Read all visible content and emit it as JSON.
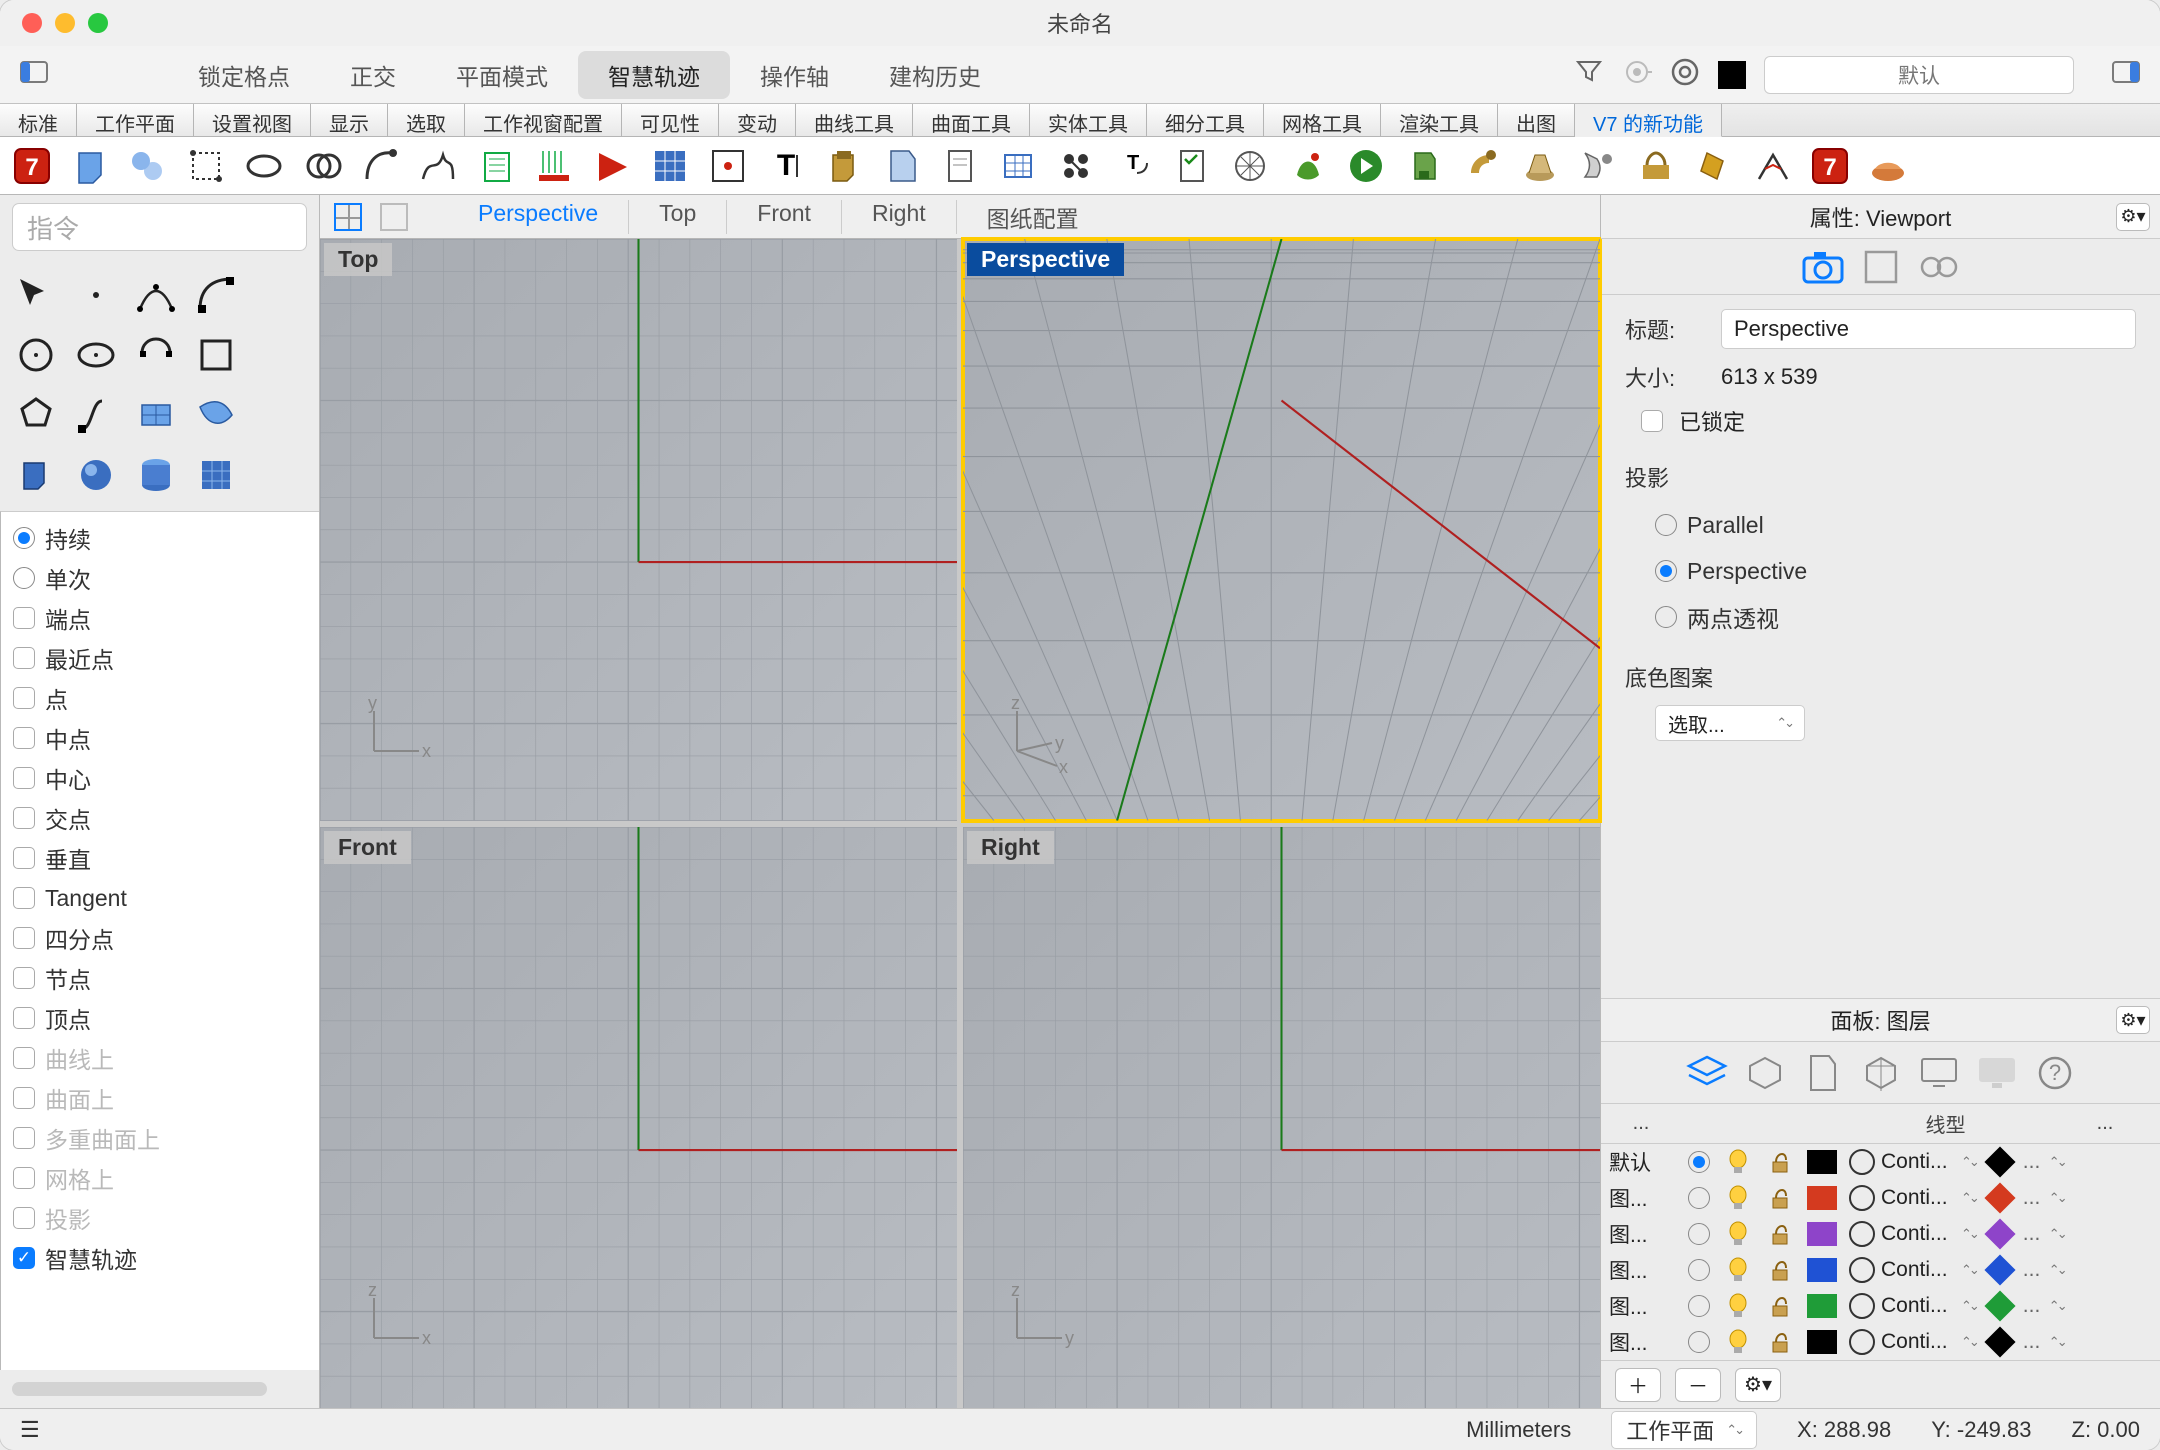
{
  "title": "未命名",
  "toolbar1": {
    "items": [
      "锁定格点",
      "正交",
      "平面模式",
      "智慧轨迹",
      "操作轴",
      "建构历史"
    ],
    "active": 3,
    "layer_selector": "默认"
  },
  "tabs": {
    "items": [
      "标准",
      "工作平面",
      "设置视图",
      "显示",
      "选取",
      "工作视窗配置",
      "可见性",
      "变动",
      "曲线工具",
      "曲面工具",
      "实体工具",
      "细分工具",
      "网格工具",
      "渲染工具",
      "出图",
      "V7 的新功能"
    ],
    "active": 15
  },
  "command_placeholder": "指令",
  "osnap": {
    "mode": [
      {
        "label": "持续",
        "on": true
      },
      {
        "label": "单次",
        "on": false
      }
    ],
    "checks": [
      {
        "label": "端点",
        "on": false,
        "disabled": false
      },
      {
        "label": "最近点",
        "on": false,
        "disabled": false
      },
      {
        "label": "点",
        "on": false,
        "disabled": false
      },
      {
        "label": "中点",
        "on": false,
        "disabled": false
      },
      {
        "label": "中心",
        "on": false,
        "disabled": false
      },
      {
        "label": "交点",
        "on": false,
        "disabled": false
      },
      {
        "label": "垂直",
        "on": false,
        "disabled": false
      },
      {
        "label": "Tangent",
        "on": false,
        "disabled": false
      },
      {
        "label": "四分点",
        "on": false,
        "disabled": false
      },
      {
        "label": "节点",
        "on": false,
        "disabled": false
      },
      {
        "label": "顶点",
        "on": false,
        "disabled": false
      },
      {
        "label": "曲线上",
        "on": false,
        "disabled": true
      },
      {
        "label": "曲面上",
        "on": false,
        "disabled": true
      },
      {
        "label": "多重曲面上",
        "on": false,
        "disabled": true
      },
      {
        "label": "网格上",
        "on": false,
        "disabled": true
      },
      {
        "label": "投影",
        "on": false,
        "disabled": true
      },
      {
        "label": "智慧轨迹",
        "on": true,
        "disabled": false
      }
    ]
  },
  "viewport_tabs": [
    "Perspective",
    "Top",
    "Front",
    "Right",
    "图纸配置"
  ],
  "viewport_active_tab": 0,
  "viewports": [
    {
      "name": "Top",
      "axes": [
        "x",
        "y"
      ],
      "active": false
    },
    {
      "name": "Perspective",
      "axes": [
        "x",
        "y",
        "z"
      ],
      "active": true
    },
    {
      "name": "Front",
      "axes": [
        "x",
        "z"
      ],
      "active": false
    },
    {
      "name": "Right",
      "axes": [
        "y",
        "z"
      ],
      "active": false
    }
  ],
  "properties": {
    "header": "属性: Viewport",
    "title_label": "标题:",
    "title_value": "Perspective",
    "size_label": "大小:",
    "size_value": "613 x 539",
    "locked_label": "已锁定",
    "projection_label": "投影",
    "projection_opts": [
      "Parallel",
      "Perspective",
      "两点透视"
    ],
    "projection_selected": 1,
    "wallpaper_label": "底色图案",
    "select_label": "选取..."
  },
  "layers": {
    "header": "面板: 图层",
    "col_linetype": "线型",
    "ellipsis": "...",
    "rows": [
      {
        "name": "默认",
        "on": true,
        "color": "#000000"
      },
      {
        "name": "图...",
        "on": false,
        "color": "#d43a1f"
      },
      {
        "name": "图...",
        "on": false,
        "color": "#8e44c9"
      },
      {
        "name": "图...",
        "on": false,
        "color": "#1f52d4"
      },
      {
        "name": "图...",
        "on": false,
        "color": "#1f9c38"
      },
      {
        "name": "图...",
        "on": false,
        "color": "#000000"
      }
    ],
    "linetype": "Conti..."
  },
  "statusbar": {
    "units": "Millimeters",
    "cplane": "工作平面",
    "x": "X: 288.98",
    "y": "Y: -249.83",
    "z": "Z: 0.00"
  }
}
